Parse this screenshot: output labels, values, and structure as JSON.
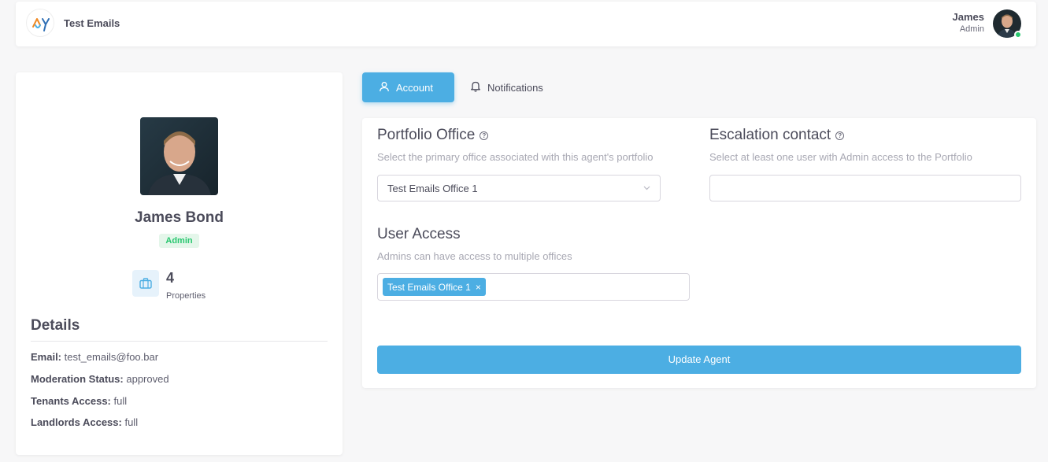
{
  "header": {
    "app_title": "Test Emails",
    "user_name": "James",
    "user_role": "Admin",
    "logo_icon": "brand-logo-icon",
    "avatar_icon": "user-avatar"
  },
  "profile": {
    "name": "James Bond",
    "role_badge": "Admin",
    "stat_value": "4",
    "stat_label": "Properties",
    "stat_icon": "briefcase-icon",
    "details_title": "Details",
    "details": [
      {
        "label": "Email:",
        "value": "test_emails@foo.bar"
      },
      {
        "label": "Moderation Status:",
        "value": "approved"
      },
      {
        "label": "Tenants Access:",
        "value": "full"
      },
      {
        "label": "Landlords Access:",
        "value": "full"
      }
    ]
  },
  "tabs": [
    {
      "label": "Account",
      "icon": "user-icon",
      "active": true
    },
    {
      "label": "Notifications",
      "icon": "bell-icon",
      "active": false
    }
  ],
  "form": {
    "portfolio_office": {
      "title": "Portfolio Office",
      "subtitle": "Select the primary office associated with this agent's portfolio",
      "selected": "Test Emails Office 1"
    },
    "escalation_contact": {
      "title": "Escalation contact",
      "subtitle": "Select at least one user with Admin access to the Portfolio",
      "value": ""
    },
    "user_access": {
      "title": "User Access",
      "subtitle": "Admins can have access to multiple offices",
      "chips": [
        "Test Emails Office 1"
      ]
    },
    "submit_label": "Update Agent"
  },
  "colors": {
    "accent": "#4caee3",
    "success": "#28c76f",
    "background": "#f7f7f8"
  }
}
